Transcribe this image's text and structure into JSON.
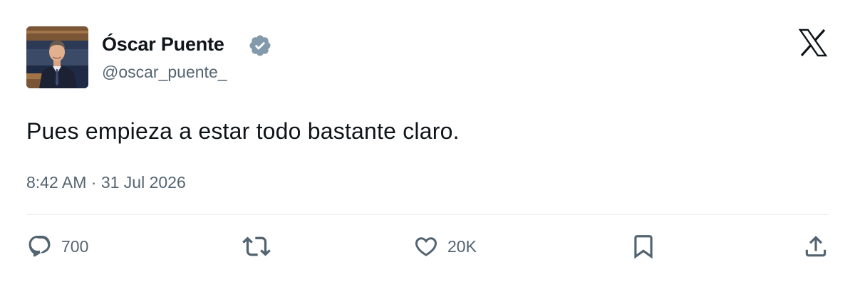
{
  "author": {
    "display_name": "Óscar Puente",
    "handle": "@oscar_puente_",
    "verified": true
  },
  "tweet": {
    "text": "Pues empieza a estar todo bastante claro.",
    "timestamp": "8:42 AM · 31 Jul 2026"
  },
  "actions": {
    "reply_count": "700",
    "like_count": "20K"
  },
  "icons": {
    "platform_logo": "x-logo-icon",
    "verified_badge": "verified-badge-icon",
    "reply": "reply-icon",
    "retweet": "retweet-icon",
    "like": "heart-icon",
    "bookmark": "bookmark-icon",
    "share": "share-icon"
  },
  "colors": {
    "text": "#0f1419",
    "secondary_text": "#536471",
    "verified": "#829aab",
    "divider": "#e6e9eb"
  }
}
